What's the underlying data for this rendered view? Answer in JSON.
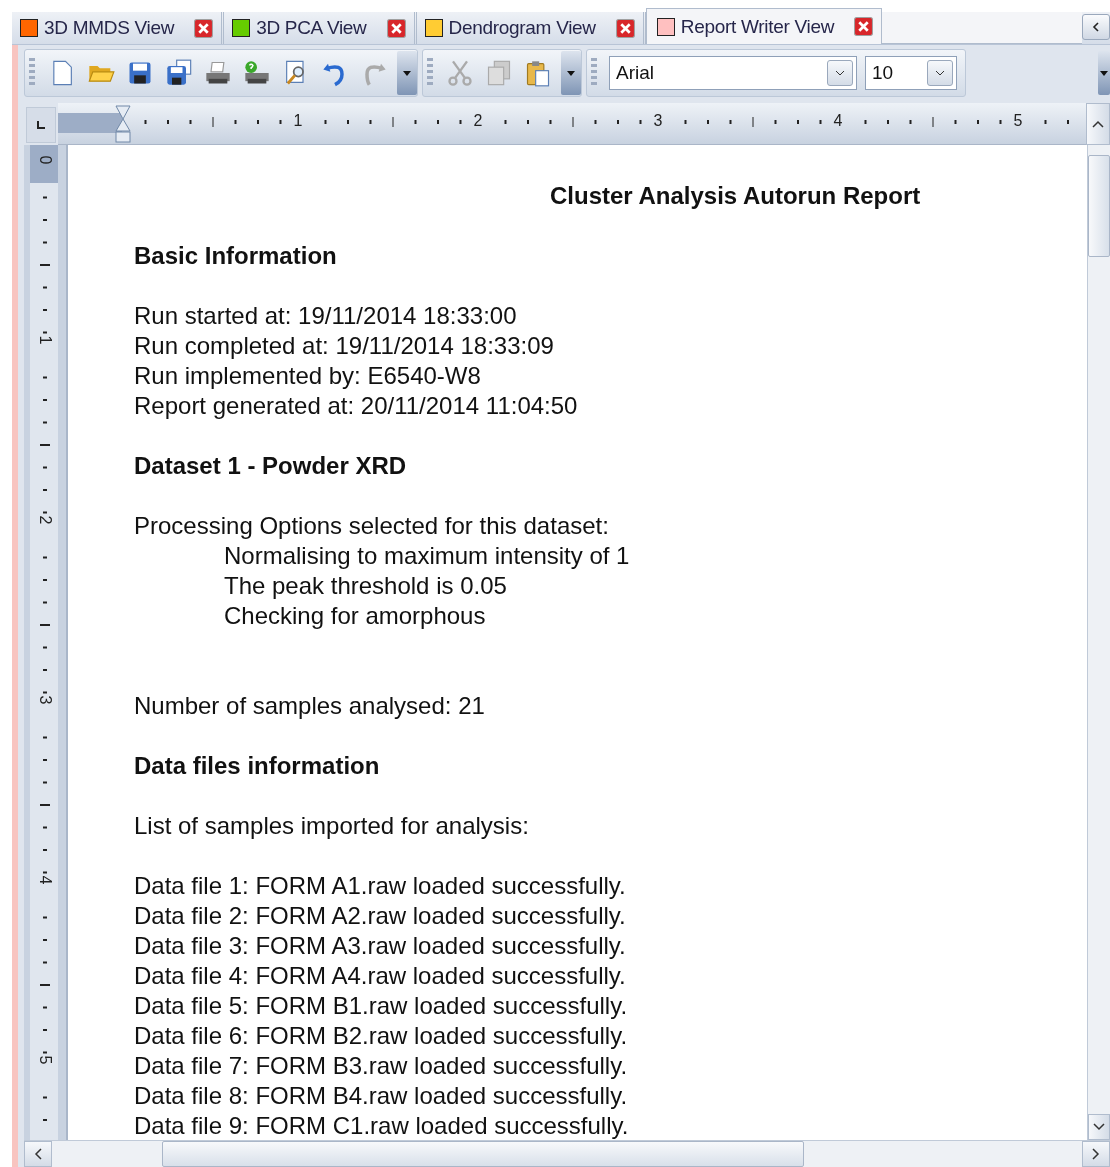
{
  "tabs": [
    {
      "label": "3D MMDS View",
      "color": "#ff6600",
      "selected": false
    },
    {
      "label": "3D PCA View",
      "color": "#66cc00",
      "selected": false
    },
    {
      "label": "Dendrogram View",
      "color": "#ffcc33",
      "selected": false
    },
    {
      "label": "Report Writer View",
      "color": "#ffc0c0",
      "selected": true
    }
  ],
  "toolbar": {
    "font": "Arial",
    "size": "10"
  },
  "ruler": {
    "horizontal": [
      "1",
      "2",
      "3",
      "4",
      "5"
    ],
    "vertical": [
      "0",
      "1",
      "2",
      "3",
      "4",
      "5"
    ]
  },
  "document": {
    "title": "Cluster Analysis Autorun Report",
    "blocks": [
      {
        "kind": "heading",
        "lines": [
          "Basic Information"
        ]
      },
      {
        "kind": "text",
        "lines": [
          "Run started at: 19/11/2014 18:33:00",
          "Run completed at: 19/11/2014 18:33:09",
          "Run implemented by: E6540-W8",
          "Report generated at: 20/11/2014 11:04:50"
        ]
      },
      {
        "kind": "heading",
        "lines": [
          "Dataset 1  - Powder XRD"
        ]
      },
      {
        "kind": "options",
        "lines": [
          "Processing Options selected for this dataset:",
          "Normalising to maximum intensity of 1",
          "The peak threshold is 0.05",
          "Checking for amorphous"
        ]
      },
      {
        "kind": "text",
        "lines": [
          "Number of samples analysed: 21"
        ]
      },
      {
        "kind": "heading",
        "lines": [
          "Data files information"
        ]
      },
      {
        "kind": "text",
        "lines": [
          "List of samples imported for analysis:"
        ]
      },
      {
        "kind": "text",
        "lines": [
          "Data file 1: FORM A1.raw loaded successfully.",
          "Data file 2: FORM A2.raw loaded successfully.",
          "Data file 3: FORM A3.raw loaded successfully.",
          "Data file 4: FORM A4.raw loaded successfully.",
          "Data file 5: FORM B1.raw loaded successfully.",
          "Data file 6: FORM B2.raw loaded successfully.",
          "Data file 7: FORM B3.raw loaded successfully.",
          "Data file 8: FORM B4.raw loaded successfully.",
          "Data file 9: FORM C1.raw loaded successfully."
        ]
      }
    ]
  }
}
